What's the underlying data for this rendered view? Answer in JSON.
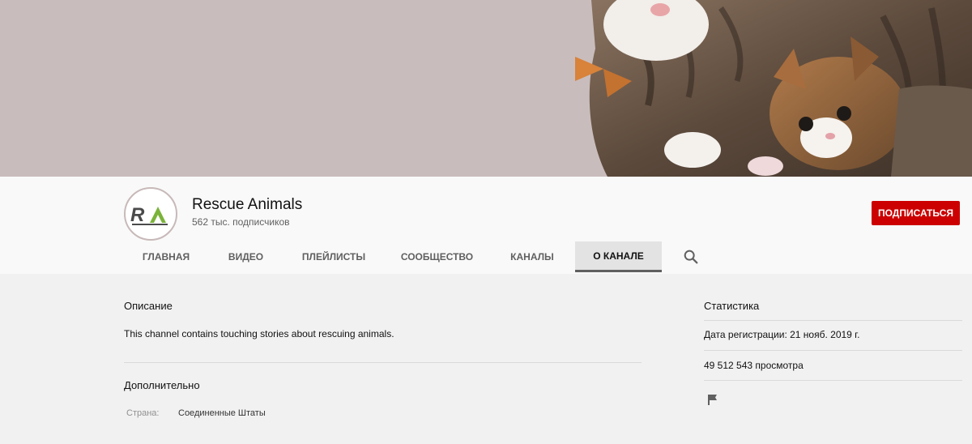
{
  "channel": {
    "name": "Rescue Animals",
    "subscribers": "562 тыс. подписчиков",
    "avatar_initials": "RA",
    "subscribe_label": "ПОДПИСАТЬСЯ",
    "banner_bg_color": "#c9bcbc",
    "subscribe_color": "#cc0000"
  },
  "tabs": [
    {
      "label": "Главная",
      "active": false
    },
    {
      "label": "Видео",
      "active": false
    },
    {
      "label": "Плейлисты",
      "active": false
    },
    {
      "label": "Сообщество",
      "active": false
    },
    {
      "label": "Каналы",
      "active": false
    },
    {
      "label": "О канале",
      "active": true
    }
  ],
  "search_icon": "search-icon",
  "about": {
    "description_title": "Описание",
    "description_text": "This channel contains touching stories about rescuing animals.",
    "details_title": "Дополнительно",
    "country_label": "Страна:",
    "country_value": "Соединенные Штаты"
  },
  "stats": {
    "title": "Статистика",
    "joined": "Дата регистрации: 21 нояб. 2019 г.",
    "views": "49 512 543 просмотра",
    "flag_icon": "flag-icon"
  }
}
